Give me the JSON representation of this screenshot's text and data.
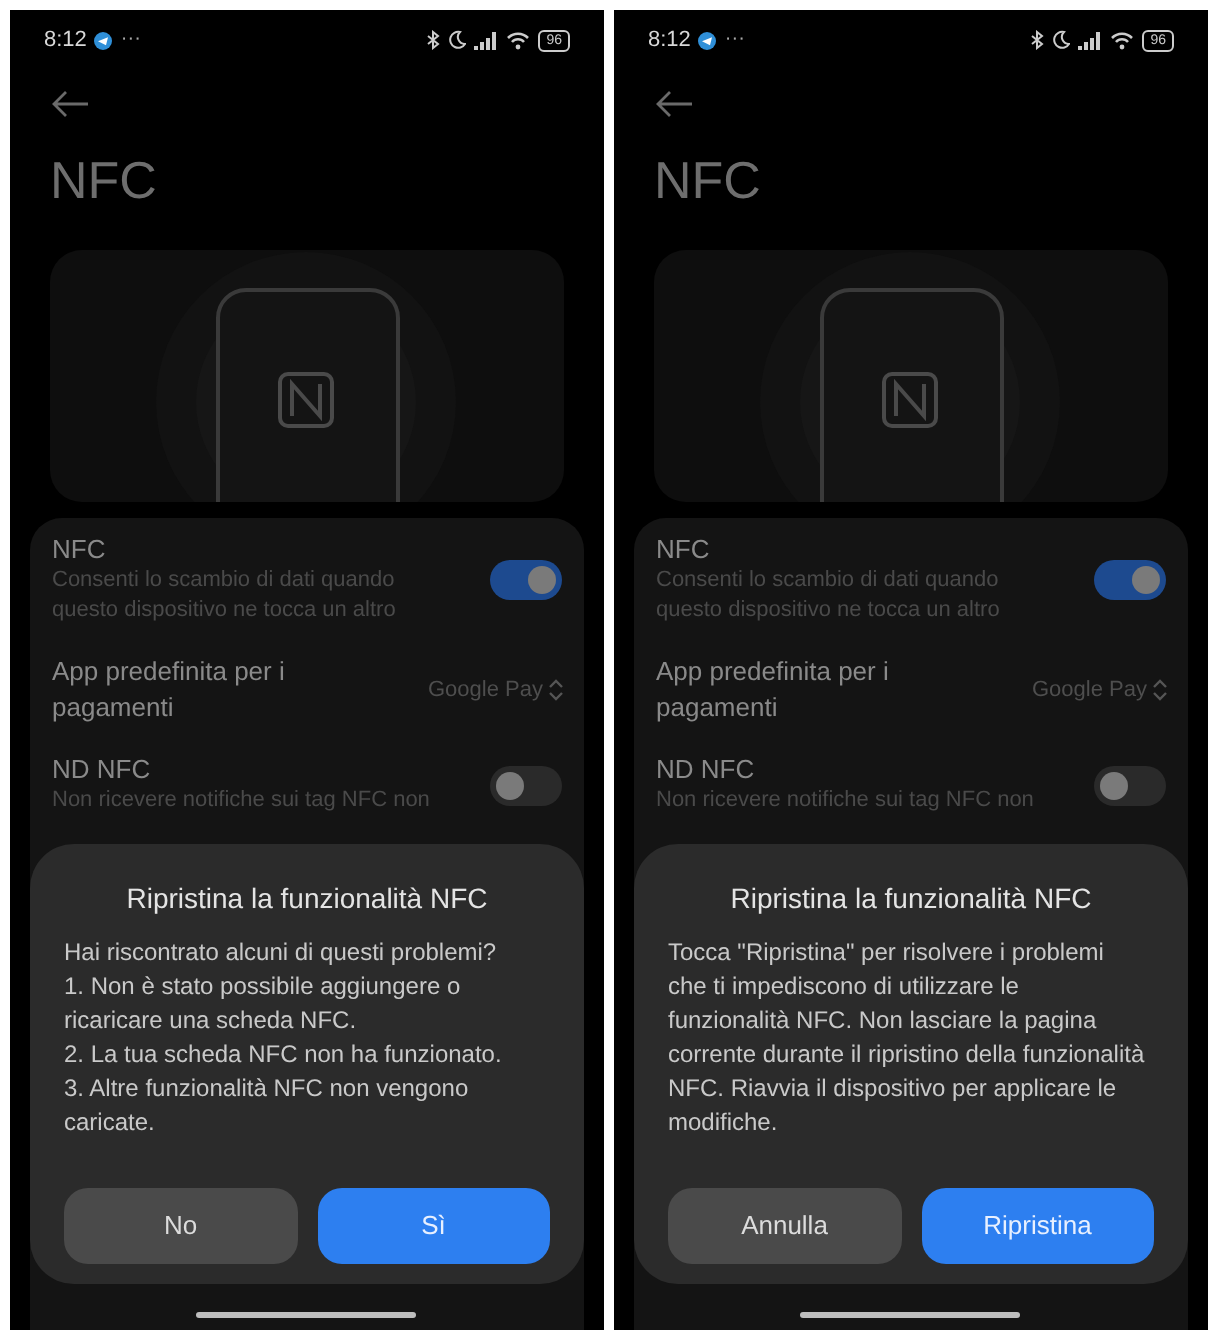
{
  "screens": [
    {
      "status_bar": {
        "time": "8:12",
        "more": "···",
        "battery": "96"
      },
      "title": "NFC",
      "settings": [
        {
          "kind": "toggle",
          "title": "NFC",
          "subtitle": "Consenti lo scambio di dati quando questo dispositivo ne tocca un altro",
          "on": true
        },
        {
          "kind": "select",
          "title": "App predefinita per i pagamenti",
          "value": "Google Pay"
        },
        {
          "kind": "toggle",
          "title": "ND NFC",
          "subtitle": "Non ricevere notifiche sui tag NFC non",
          "on": false
        }
      ],
      "dialog": {
        "title": "Ripristina la funzionalità NFC",
        "body": [
          "Hai riscontrato alcuni di questi problemi?",
          "1. Non è stato possibile aggiungere o ricaricare una scheda NFC.",
          "2. La tua scheda NFC non ha funzionato.",
          "3. Altre funzionalità NFC non vengono caricate."
        ],
        "buttons": [
          {
            "label": "No",
            "kind": "secondary"
          },
          {
            "label": "Sì",
            "kind": "primary"
          }
        ]
      }
    },
    {
      "status_bar": {
        "time": "8:12",
        "more": "···",
        "battery": "96"
      },
      "title": "NFC",
      "settings": [
        {
          "kind": "toggle",
          "title": "NFC",
          "subtitle": "Consenti lo scambio di dati quando questo dispositivo ne tocca un altro",
          "on": true
        },
        {
          "kind": "select",
          "title": "App predefinita per i pagamenti",
          "value": "Google Pay"
        },
        {
          "kind": "toggle",
          "title": "ND NFC",
          "subtitle": "Non ricevere notifiche sui tag NFC non",
          "on": false
        }
      ],
      "dialog": {
        "title": "Ripristina la funzionalità NFC",
        "body": [
          "Tocca \"Ripristina\" per risolvere i problemi che ti impediscono di utilizzare le funzionalità NFC. Non lasciare la pagina corrente durante il ripristino della funzionalità NFC. Riavvia il dispositivo per applicare le modifiche."
        ],
        "buttons": [
          {
            "label": "Annulla",
            "kind": "secondary"
          },
          {
            "label": "Ripristina",
            "kind": "primary"
          }
        ]
      }
    }
  ]
}
